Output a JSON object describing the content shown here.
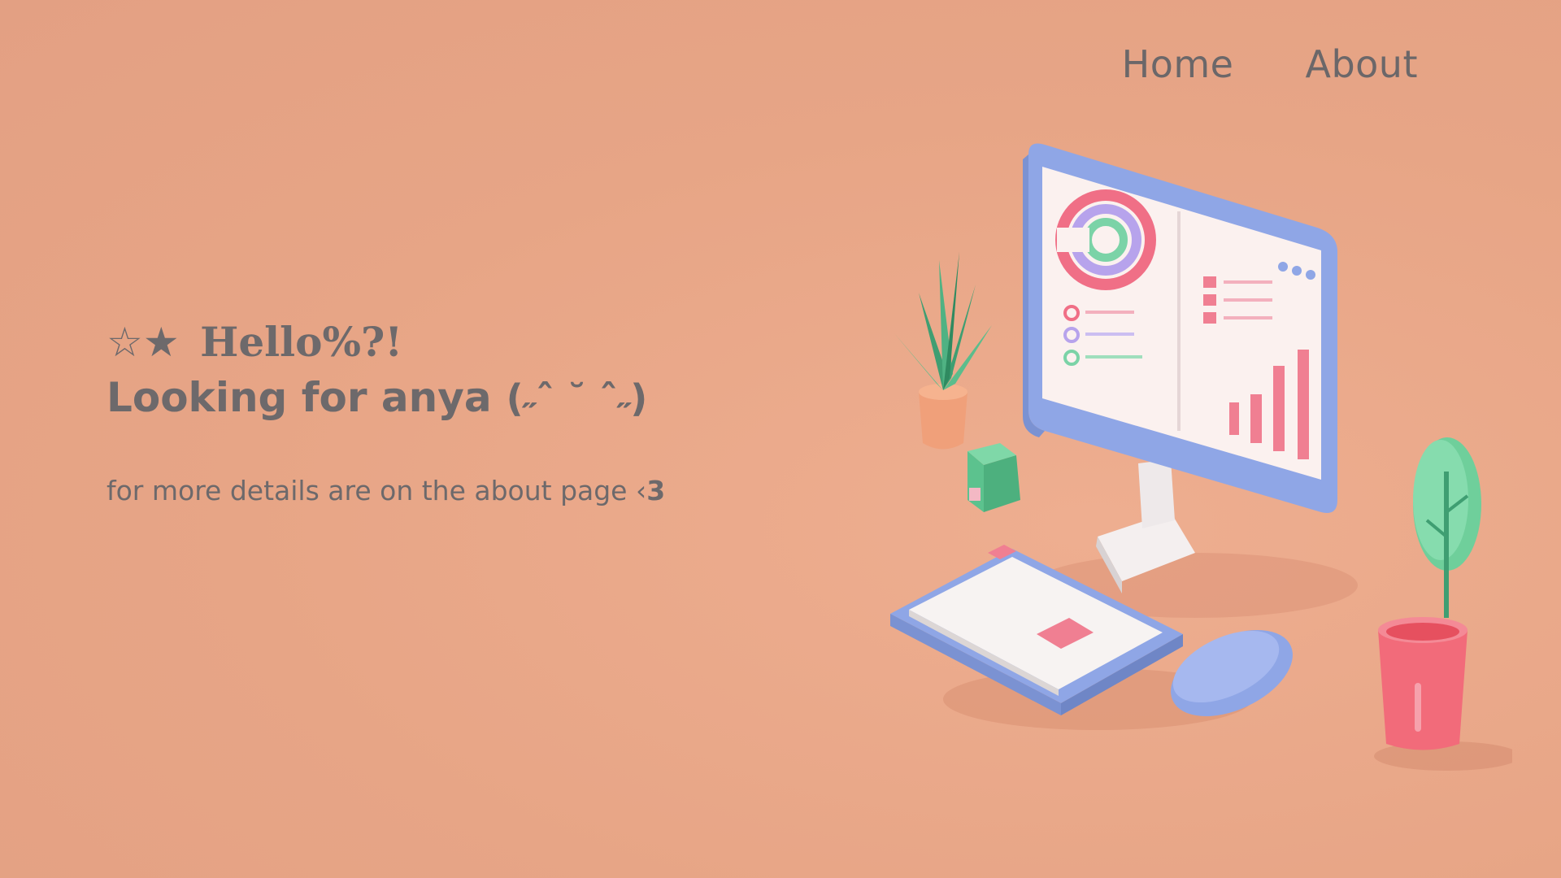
{
  "nav": {
    "items": [
      {
        "label": "Home"
      },
      {
        "label": "About"
      }
    ]
  },
  "hero": {
    "stars": "☆★",
    "greeting": "Hello%?!",
    "looking": "Looking for anya",
    "kaomoji": "(˶ˆ ˘ ˆ˶)",
    "subtext": "for more details are on the about page ‹",
    "heart": "3"
  },
  "colors": {
    "background": "#e8a88a",
    "text": "#6d696b",
    "monitor": "#8fa6e6",
    "plant": "#6fcf9b",
    "cup": "#f26b7a"
  },
  "illustration": {
    "icon": "desk-setup-illustration"
  }
}
